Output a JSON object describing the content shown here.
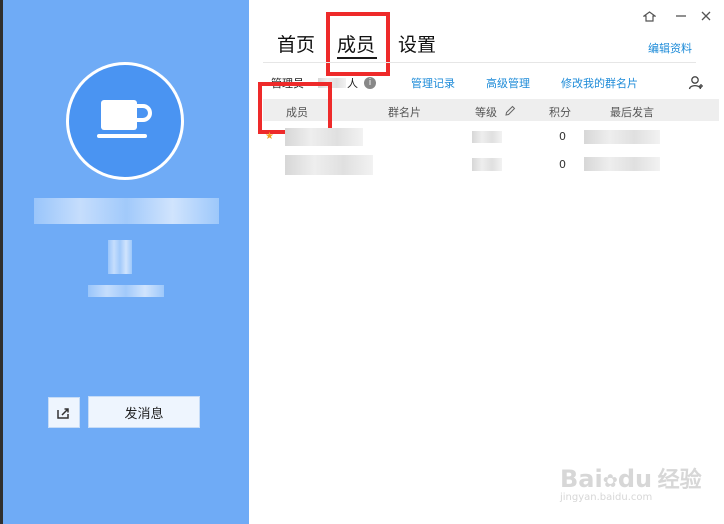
{
  "tabs": [
    {
      "label": "首页",
      "active": false
    },
    {
      "label": "成员",
      "active": true
    },
    {
      "label": "设置",
      "active": false
    }
  ],
  "header": {
    "edit_profile": "编辑资料"
  },
  "subtoolbar": {
    "admin_label": "管理员",
    "count_suffix": "人",
    "manage_log": "管理记录",
    "advanced_manage": "高级管理",
    "edit_card": "修改我的群名片"
  },
  "table": {
    "columns": [
      "成员",
      "群名片",
      "等级",
      "积分",
      "最后发言"
    ],
    "rows": [
      {
        "points": "0",
        "admin_mark": "★"
      },
      {
        "points": "0"
      }
    ]
  },
  "left": {
    "send_message": "发消息"
  },
  "watermark": {
    "brand": "Bai",
    "brand2": "du",
    "cn": "经验",
    "url": "jingyan.baidu.com"
  },
  "colors": {
    "left_panel": "#6fabf6",
    "avatar": "#4a94f2",
    "link": "#1d8bd8",
    "highlight": "#ee2a2a"
  },
  "icons": [
    "coffee-cup-icon",
    "share-icon",
    "skin-icon",
    "minimize-icon",
    "close-icon",
    "pencil-icon",
    "add-member-icon",
    "info-icon"
  ]
}
